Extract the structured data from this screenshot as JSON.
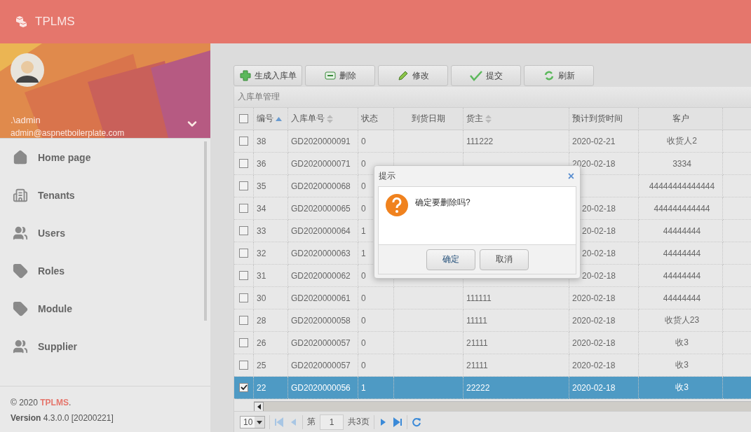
{
  "app": {
    "title": "TPLMS"
  },
  "user": {
    "name": ".\\admin",
    "email": "admin@aspnetboilerplate.com"
  },
  "menu": [
    {
      "label": "Home page",
      "kind": "home"
    },
    {
      "label": "Tenants",
      "kind": "building"
    },
    {
      "label": "Users",
      "kind": "people"
    },
    {
      "label": "Roles",
      "kind": "tag"
    },
    {
      "label": "Module",
      "kind": "tag"
    },
    {
      "label": "Supplier",
      "kind": "people"
    }
  ],
  "footer": {
    "copyright": "© 2020 ",
    "brand": "TPLMS",
    "period": ".",
    "version_label": "Version",
    "version": "4.3.0.0 [20200221]"
  },
  "toolbar": [
    {
      "label": "生成入库单",
      "kind": "add"
    },
    {
      "label": "删除",
      "kind": "remove"
    },
    {
      "label": "修改",
      "kind": "edit"
    },
    {
      "label": "提交",
      "kind": "submit"
    },
    {
      "label": "刷新",
      "kind": "reload"
    }
  ],
  "grid": {
    "title": "入库单管理",
    "all_checked": false,
    "columns": [
      {
        "label": "编号",
        "sortable": true,
        "sorted": true
      },
      {
        "label": "入库单号",
        "sortable": true,
        "sorted": false
      },
      {
        "label": "状态",
        "sortable": false
      },
      {
        "label": "到货日期",
        "sortable": false
      },
      {
        "label": "货主",
        "sortable": true,
        "sorted": false
      },
      {
        "label": "预计到货时间",
        "sortable": false
      },
      {
        "label": "客户",
        "sortable": false
      }
    ],
    "rows": [
      {
        "id": "38",
        "code": "GD2020000091",
        "status": "0",
        "owner": "111222",
        "eta": "2020-02-21",
        "customer": "收货人2",
        "selected": false
      },
      {
        "id": "36",
        "code": "GD2020000071",
        "status": "0",
        "eta": "2020-02-18",
        "customer": "3334",
        "selected": false
      },
      {
        "id": "35",
        "code": "GD2020000068",
        "status": "0",
        "customer": "44444444444444",
        "selected": false
      },
      {
        "id": "34",
        "code": "GD2020000065",
        "status": "0",
        "eta": "20-02-18",
        "eta_cut": true,
        "customer": "444444444444",
        "selected": false
      },
      {
        "id": "33",
        "code": "GD2020000064",
        "status": "1",
        "eta": "20-02-18",
        "eta_cut": true,
        "customer": "44444444",
        "selected": false
      },
      {
        "id": "32",
        "code": "GD2020000063",
        "status": "1",
        "eta": "20-02-18",
        "eta_cut": true,
        "customer": "44444444",
        "selected": false
      },
      {
        "id": "31",
        "code": "GD2020000062",
        "status": "0",
        "eta": "20-02-18",
        "eta_cut": true,
        "customer": "44444444",
        "selected": false
      },
      {
        "id": "30",
        "code": "GD2020000061",
        "status": "0",
        "owner": "111111",
        "eta": "2020-02-18",
        "customer": "44444444",
        "selected": false
      },
      {
        "id": "28",
        "code": "GD2020000058",
        "status": "0",
        "owner": "11111",
        "eta": "2020-02-18",
        "customer": "收货人23",
        "selected": false
      },
      {
        "id": "26",
        "code": "GD2020000057",
        "status": "0",
        "owner": "21111",
        "eta": "2020-02-18",
        "customer": "收3",
        "selected": false
      },
      {
        "id": "25",
        "code": "GD2020000057",
        "status": "0",
        "owner": "21111",
        "eta": "2020-02-18",
        "customer": "收3",
        "selected": false
      },
      {
        "id": "22",
        "code": "GD2020000056",
        "status": "1",
        "owner": "22222",
        "eta": "2020-02-18",
        "customer": "收3",
        "selected": true
      }
    ],
    "pager": {
      "page_size": "10",
      "page_prefix": "第",
      "page": "1",
      "page_suffix": "共3页"
    }
  },
  "dialog": {
    "title": "提示",
    "close": "×",
    "message": "确定要删除吗?",
    "buttons": [
      "确定",
      "取消"
    ]
  }
}
